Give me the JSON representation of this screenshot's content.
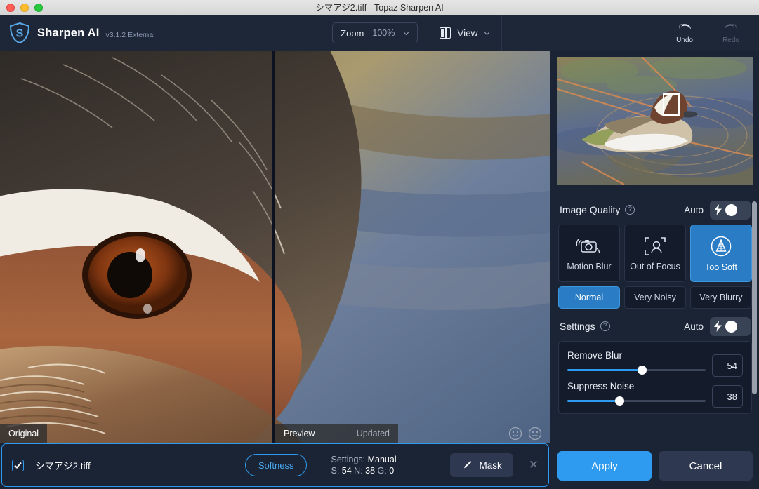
{
  "window": {
    "title": "シマアジ2.tiff - Topaz Sharpen AI",
    "traffic_lights": [
      "close-button",
      "minimize-button",
      "zoom-button"
    ]
  },
  "toolbar": {
    "brand_name": "Sharpen AI",
    "brand_version": "v3.1.2 External",
    "zoom_label": "Zoom",
    "zoom_value": "100%",
    "view_label": "View",
    "undo_label": "Undo",
    "redo_label": "Redo"
  },
  "viewer": {
    "original_label": "Original",
    "preview_label": "Preview",
    "preview_status": "Updated",
    "progress_color": "#2f9e4f"
  },
  "filebar": {
    "filename": "シマアジ2.tiff",
    "checked": true,
    "softness_label": "Softness",
    "settings_prefix": "Settings:",
    "settings_mode": "Manual",
    "s_label": "S:",
    "s_value": "54",
    "n_label": "N:",
    "n_value": "38",
    "g_label": "G:",
    "g_value": "0",
    "mask_label": "Mask",
    "close_label": "✕"
  },
  "sidebar": {
    "image_quality": {
      "title": "Image Quality",
      "auto_label": "Auto",
      "auto_on": true,
      "models": [
        {
          "label": "Motion Blur",
          "icon": "motion-blur-icon",
          "selected": false
        },
        {
          "label": "Out of Focus",
          "icon": "out-of-focus-icon",
          "selected": false
        },
        {
          "label": "Too Soft",
          "icon": "too-soft-icon",
          "selected": true
        }
      ],
      "levels": [
        {
          "label": "Normal",
          "selected": true
        },
        {
          "label": "Very Noisy",
          "selected": false
        },
        {
          "label": "Very Blurry",
          "selected": false
        }
      ]
    },
    "settings": {
      "title": "Settings",
      "auto_label": "Auto",
      "auto_on": true,
      "sliders": [
        {
          "label": "Remove Blur",
          "value": "54",
          "percent": 54
        },
        {
          "label": "Suppress Noise",
          "value": "38",
          "percent": 38
        }
      ]
    }
  },
  "actions": {
    "apply_label": "Apply",
    "cancel_label": "Cancel"
  },
  "colors": {
    "accent": "#2f9bf0",
    "panel_bg": "#1b2435",
    "card_bg": "#141c2b",
    "selected": "#2a7dc4"
  }
}
